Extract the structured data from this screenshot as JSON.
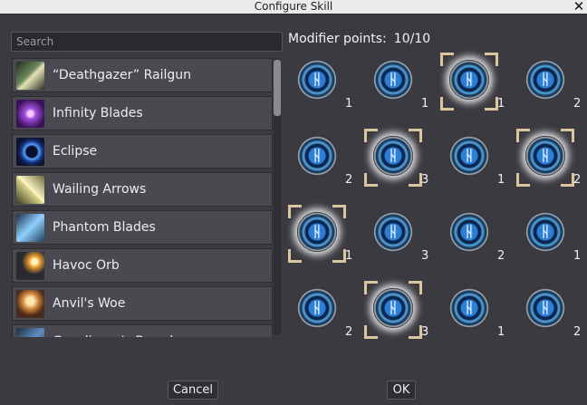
{
  "window": {
    "title": "Configure Skill",
    "close_glyph": "✕"
  },
  "search": {
    "placeholder": "Search",
    "value": ""
  },
  "skills": [
    {
      "label": "“Deathgazer” Railgun"
    },
    {
      "label": "Infinity Blades"
    },
    {
      "label": "Eclipse"
    },
    {
      "label": "Wailing Arrows"
    },
    {
      "label": "Phantom Blades"
    },
    {
      "label": "Havoc Orb"
    },
    {
      "label": "Anvil's Woe"
    },
    {
      "label": "Gunslinger's Brand"
    }
  ],
  "modifier_points": {
    "label": "Modifier points:",
    "value": "10/10"
  },
  "modifiers": [
    {
      "count": "1",
      "selected": false
    },
    {
      "count": "1",
      "selected": false
    },
    {
      "count": "1",
      "selected": true
    },
    {
      "count": "2",
      "selected": false
    },
    {
      "count": "2",
      "selected": false
    },
    {
      "count": "3",
      "selected": true
    },
    {
      "count": "1",
      "selected": false
    },
    {
      "count": "2",
      "selected": true
    },
    {
      "count": "1",
      "selected": true
    },
    {
      "count": "3",
      "selected": false
    },
    {
      "count": "2",
      "selected": false
    },
    {
      "count": "1",
      "selected": false
    },
    {
      "count": "2",
      "selected": false
    },
    {
      "count": "3",
      "selected": true
    },
    {
      "count": "1",
      "selected": false
    },
    {
      "count": "2",
      "selected": false
    }
  ],
  "rune_glyph": "ᚺ",
  "buttons": {
    "cancel": "Cancel",
    "ok": "OK"
  },
  "colors": {
    "background": "#3b3a40",
    "accent_frame": "#d9c69c",
    "gem_blue": "#2b7fd8"
  }
}
